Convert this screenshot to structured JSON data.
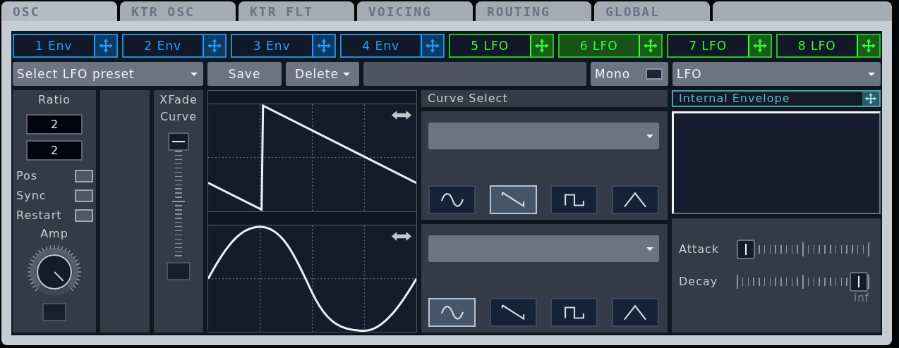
{
  "tabs": [
    {
      "label": "OSC",
      "selected": true
    },
    {
      "label": "KTR OSC",
      "selected": false
    },
    {
      "label": "KTR FLT",
      "selected": false
    },
    {
      "label": "VOICING",
      "selected": false
    },
    {
      "label": "ROUTING",
      "selected": false
    },
    {
      "label": "GLOBAL",
      "selected": false
    }
  ],
  "slots": [
    {
      "label": "1 Env",
      "kind": "env",
      "selected": false
    },
    {
      "label": "2 Env",
      "kind": "env",
      "selected": false
    },
    {
      "label": "3 Env",
      "kind": "env",
      "selected": false
    },
    {
      "label": "4 Env",
      "kind": "env",
      "selected": false
    },
    {
      "label": "5 LFO",
      "kind": "lfo",
      "selected": false
    },
    {
      "label": "6 LFO",
      "kind": "lfo",
      "selected": true
    },
    {
      "label": "7 LFO",
      "kind": "lfo",
      "selected": false
    },
    {
      "label": "8 LFO",
      "kind": "lfo",
      "selected": false
    }
  ],
  "preset": {
    "value": "Select LFO preset"
  },
  "save": "Save",
  "delete": "Delete",
  "mono": {
    "label": "Mono",
    "checked": false
  },
  "source": {
    "value": "LFO"
  },
  "ratio": {
    "label": "Ratio",
    "values": [
      "2",
      "2"
    ]
  },
  "toggles": [
    {
      "label": "Pos",
      "checked": false
    },
    {
      "label": "Sync",
      "checked": false
    },
    {
      "label": "Restart",
      "checked": false
    }
  ],
  "amp": {
    "label": "Amp",
    "level": 1
  },
  "xfade": {
    "lines": [
      "XFade",
      "Curve"
    ],
    "level": 1
  },
  "curve_select": {
    "title": "Curve Select",
    "groups": [
      {
        "shapes": [
          {
            "kind": "sine",
            "selected": false
          },
          {
            "kind": "saw",
            "selected": true
          },
          {
            "kind": "square",
            "selected": false
          },
          {
            "kind": "triangle",
            "selected": false
          }
        ]
      },
      {
        "shapes": [
          {
            "kind": "sine",
            "selected": true
          },
          {
            "kind": "saw",
            "selected": false
          },
          {
            "kind": "square",
            "selected": false
          },
          {
            "kind": "triangle",
            "selected": false
          }
        ]
      }
    ]
  },
  "envelope": {
    "title": "Internal Envelope",
    "params": [
      {
        "label": "Attack",
        "level": 0
      },
      {
        "label": "Decay",
        "level": 1,
        "reading": "inf"
      }
    ]
  }
}
